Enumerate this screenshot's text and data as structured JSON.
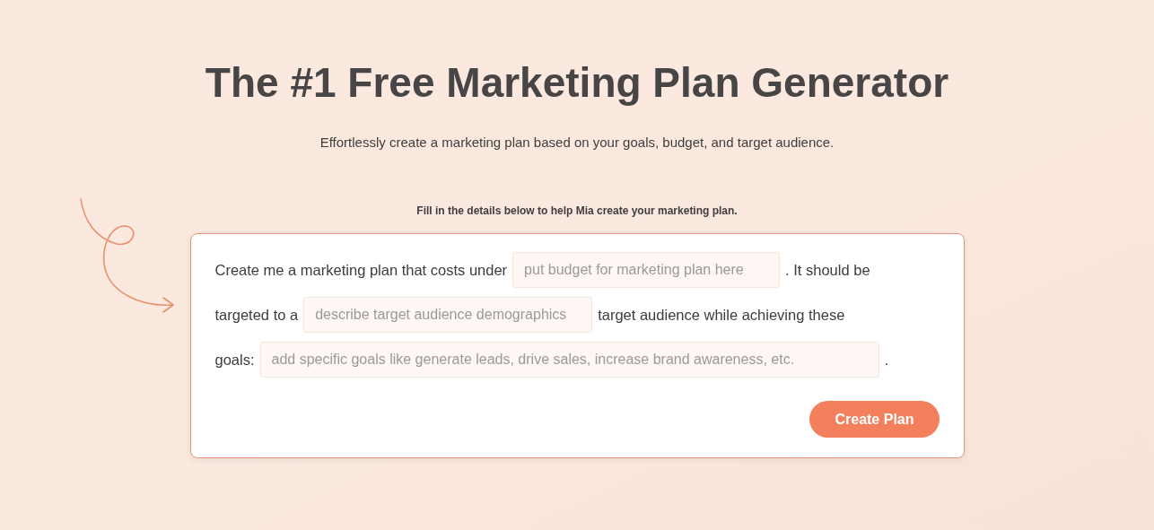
{
  "heading": "The #1 Free Marketing Plan Generator",
  "subheading": "Effortlessly create a marketing plan based on your goals, budget, and target audience.",
  "form": {
    "instruction": "Fill in the details below to help Mia create your marketing plan.",
    "lines": [
      [
        {
          "kind": "text",
          "text": "Create me a marketing plan that costs under"
        },
        {
          "kind": "field",
          "placeholder": "put budget for marketing plan here"
        },
        {
          "kind": "text",
          "text": ". It should be"
        }
      ],
      [
        {
          "kind": "text",
          "text": "targeted to a"
        },
        {
          "kind": "field",
          "placeholder": "describe target audience demographics"
        },
        {
          "kind": "text",
          "text": "target audience while achieving these"
        }
      ],
      [
        {
          "kind": "text",
          "text": "goals:"
        },
        {
          "kind": "field",
          "placeholder": "add specific goals like generate leads, drive sales, increase brand awareness, etc."
        },
        {
          "kind": "text",
          "text": "."
        }
      ]
    ],
    "submit": "Create Plan"
  }
}
